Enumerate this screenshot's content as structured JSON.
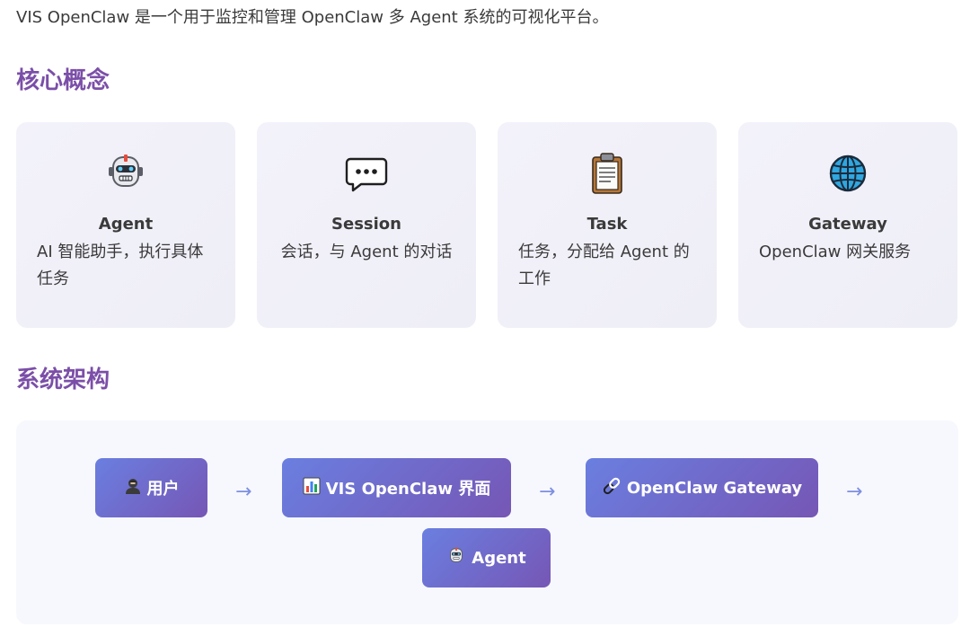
{
  "intro": "VIS OpenClaw 是一个用于监控和管理 OpenClaw 多 Agent 系统的可视化平台。",
  "concepts": {
    "title": "核心概念",
    "cards": [
      {
        "icon": "robot-icon",
        "title": "Agent",
        "desc": "AI 智能助手，执行具体任务"
      },
      {
        "icon": "speech-bubble-icon",
        "title": "Session",
        "desc": "会话，与 Agent 的对话"
      },
      {
        "icon": "clipboard-icon",
        "title": "Task",
        "desc": "任务，分配给 Agent 的工作"
      },
      {
        "icon": "globe-icon",
        "title": "Gateway",
        "desc": "OpenClaw 网关服务"
      }
    ]
  },
  "architecture": {
    "title": "系统架构",
    "nodes": [
      {
        "icon": "user-icon",
        "label": "用户"
      },
      {
        "icon": "bar-chart-icon",
        "label": "VIS OpenClaw 界面"
      },
      {
        "icon": "link-icon",
        "label": "OpenClaw Gateway"
      },
      {
        "icon": "robot-icon",
        "label": "Agent"
      }
    ],
    "arrow": "→"
  },
  "colors": {
    "heading": "#7b4fa8",
    "node_gradient_start": "#6a7fe0",
    "node_gradient_end": "#7656b5",
    "card_bg": "#f1f0f9"
  }
}
